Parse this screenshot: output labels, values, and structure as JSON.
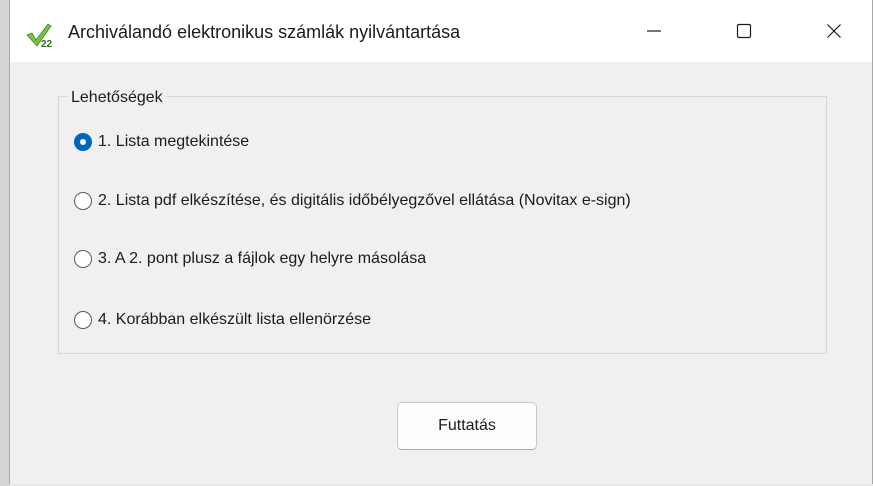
{
  "window": {
    "title": "Archiválandó elektronikus számlák nyilvántartása",
    "icon": "green-checkmark-22-icon",
    "controls": [
      "minimize",
      "maximize",
      "close"
    ]
  },
  "groupbox": {
    "label": "Lehetőségek",
    "options": [
      {
        "label": "1. Lista megtekintése",
        "selected": true
      },
      {
        "label": "2. Lista pdf elkészítése, és digitális időbélyegzővel ellátása (Novitax e-sign)",
        "selected": false
      },
      {
        "label": "3. A 2. pont plusz a fájlok egy helyre másolása",
        "selected": false
      },
      {
        "label": "4. Korábban elkészült lista ellenörzése",
        "selected": false
      }
    ]
  },
  "run_button": {
    "label": "Futtatás"
  },
  "colors": {
    "accent": "#0067c0",
    "background": "#f0f0f0",
    "titlebar": "#ffffff"
  }
}
